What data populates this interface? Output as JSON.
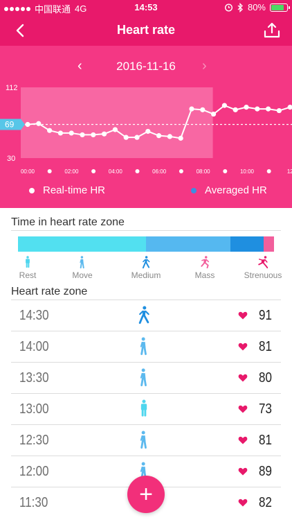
{
  "status_bar": {
    "carrier": "中国联通",
    "network": "4G",
    "time": "14:53",
    "battery": "80%",
    "battery_level": 0.8
  },
  "nav": {
    "title": "Heart rate",
    "back_icon": "chevron-left-icon",
    "share_icon": "upload-icon"
  },
  "date": {
    "label": "2016-11-16",
    "prev_icon": "chevron-left-icon",
    "next_icon": "chevron-right-icon"
  },
  "chart_data": {
    "type": "line",
    "y_ticks": [
      "112",
      "30"
    ],
    "ylim": [
      30,
      112
    ],
    "average_label": "69",
    "average_value": 69,
    "x_tick_labels": [
      "00:00",
      "02:00",
      "04:00",
      "06:00",
      "08:00",
      "10:00",
      "12:"
    ],
    "series": [
      {
        "name": "Real-time HR",
        "values": [
          69,
          70,
          62,
          59,
          59,
          57,
          57,
          58,
          63,
          54,
          54,
          61,
          56,
          55,
          53,
          87,
          86,
          81,
          91,
          86,
          89,
          87,
          87,
          85,
          89
        ]
      }
    ],
    "highlight_range_index": [
      0,
      17
    ],
    "legend": [
      "Real-time HR",
      "Averaged HR"
    ],
    "colors": {
      "background": "#f43784",
      "highlight": "#f978ad",
      "line": "#ffffff",
      "average_line": "#ffffff",
      "average_badge": "#57c6e8",
      "averaged_dot": "#3d8ee0"
    }
  },
  "zone_time": {
    "title": "Time in heart rate zone",
    "segments": [
      {
        "value": 0.5,
        "color": "#52e0f0"
      },
      {
        "value": 0.33,
        "color": "#55b8f0"
      },
      {
        "value": 0.13,
        "color": "#1f8fe0"
      },
      {
        "value": 0.04,
        "color": "#f25f9c"
      }
    ],
    "zones": [
      {
        "label": "Rest",
        "icon": "standing-person-icon",
        "color": "#4fd6ee"
      },
      {
        "label": "Move",
        "icon": "walking-person-icon",
        "color": "#5cb9ee"
      },
      {
        "label": "Medium",
        "icon": "brisk-walking-person-icon",
        "color": "#1f8fe0"
      },
      {
        "label": "Mass",
        "icon": "running-person-icon",
        "color": "#f25f9c"
      },
      {
        "label": "Strenuous",
        "icon": "sprinting-person-icon",
        "color": "#e8196b"
      }
    ]
  },
  "heart_rate_zone": {
    "title": "Heart rate zone",
    "rows": [
      {
        "time": "14:30",
        "zone": "Medium",
        "value": "91"
      },
      {
        "time": "14:00",
        "zone": "Move",
        "value": "81"
      },
      {
        "time": "13:30",
        "zone": "Move",
        "value": "80"
      },
      {
        "time": "13:00",
        "zone": "Rest",
        "value": "73"
      },
      {
        "time": "12:30",
        "zone": "Move",
        "value": "81"
      },
      {
        "time": "12:00",
        "zone": "Move",
        "value": "89"
      },
      {
        "time": "11:30",
        "zone": "Move",
        "value": "82"
      }
    ]
  },
  "fab": {
    "label": "+"
  }
}
